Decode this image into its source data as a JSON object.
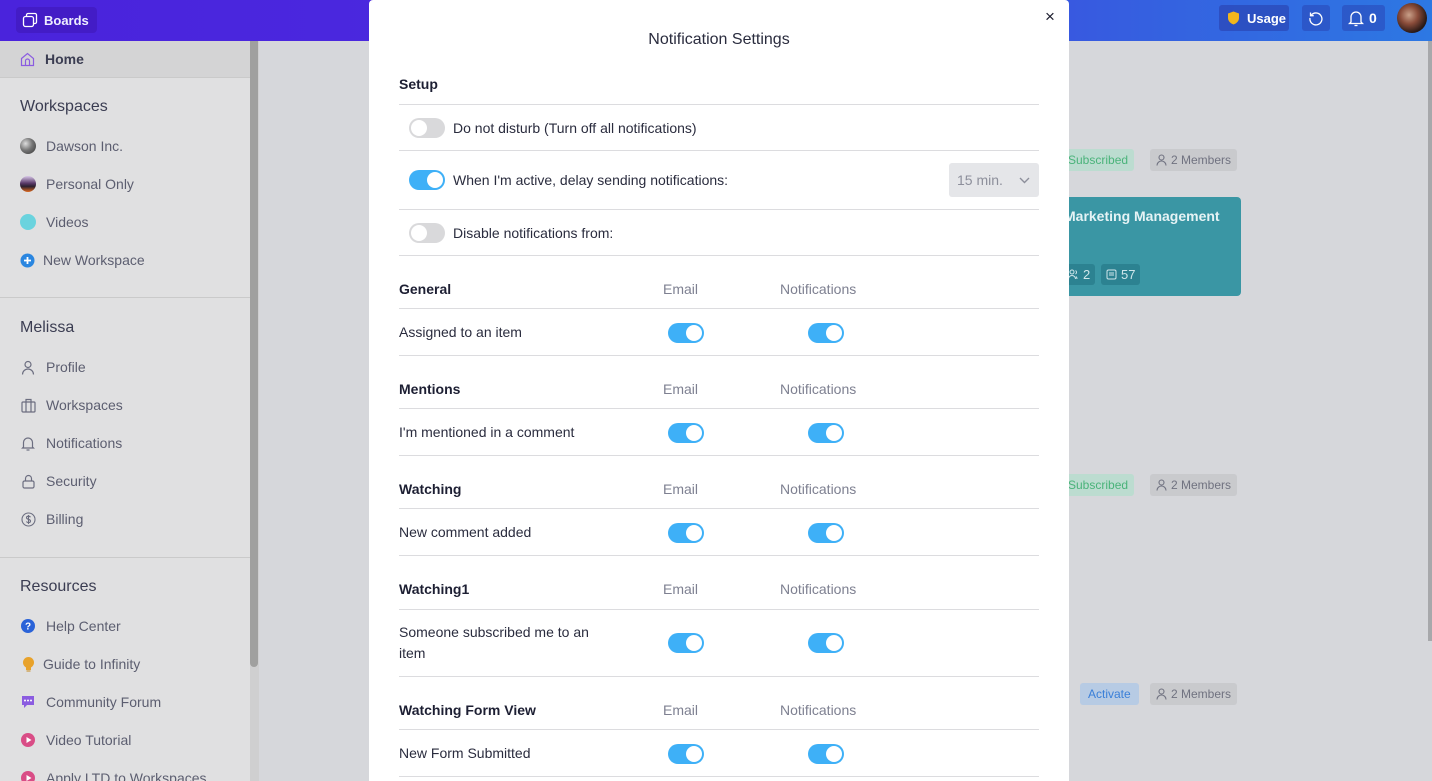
{
  "topbar": {
    "app_label": "Boards",
    "usage_label": "Usage",
    "notification_count": "0",
    "colors": {
      "usage_shield": "#f2b61d"
    }
  },
  "sidebar": {
    "home_label": "Home",
    "workspaces_heading": "Workspaces",
    "workspaces": [
      {
        "label": "Dawson Inc.",
        "color": "#6b6b6b"
      },
      {
        "label": "Personal Only",
        "color": "#5a4a6a"
      },
      {
        "label": "Videos",
        "color": "#6ad3de"
      }
    ],
    "new_workspace_label": "New Workspace",
    "user_heading": "Melissa",
    "user_items": [
      {
        "label": "Profile",
        "icon": "user-icon"
      },
      {
        "label": "Workspaces",
        "icon": "briefcase-icon"
      },
      {
        "label": "Notifications",
        "icon": "bell-icon"
      },
      {
        "label": "Security",
        "icon": "lock-icon"
      },
      {
        "label": "Billing",
        "icon": "dollar-icon"
      }
    ],
    "resources_heading": "Resources",
    "resources": [
      {
        "label": "Help Center",
        "icon": "help-icon",
        "color": "#2a63d8"
      },
      {
        "label": "Guide to Infinity",
        "icon": "lightbulb-icon",
        "color": "#e8a22a"
      },
      {
        "label": "Community Forum",
        "icon": "chat-icon",
        "color": "#8b5ce0"
      },
      {
        "label": "Video Tutorial",
        "icon": "play-icon",
        "color": "#d94d86"
      },
      {
        "label": "Apply LTD to Workspaces",
        "icon": "play-icon",
        "color": "#d94d86"
      }
    ]
  },
  "background": {
    "workspace_rows": [
      {
        "status": "Subscribed",
        "members": "2 Members"
      },
      {
        "status": "Subscribed",
        "members": "2 Members"
      },
      {
        "status": "Activate",
        "members": "2 Members"
      }
    ],
    "board_card": {
      "title": "Marketing Management",
      "members_count": "2",
      "items_count": "57",
      "color": "#3a96a4"
    }
  },
  "modal": {
    "title": "Notification Settings",
    "close_label": "×",
    "setup": {
      "heading": "Setup",
      "do_not_disturb": {
        "label": "Do not disturb (Turn off all notifications)",
        "on": false
      },
      "delay": {
        "label": "When I'm active, delay sending notifications:",
        "on": true,
        "value": "15 min."
      },
      "disable_from": {
        "label": "Disable notifications from:",
        "on": false
      }
    },
    "column_email": "Email",
    "column_notifications": "Notifications",
    "sections": [
      {
        "heading": "General",
        "rows": [
          {
            "label": "Assigned to an item",
            "email": true,
            "notifications": true
          }
        ]
      },
      {
        "heading": "Mentions",
        "rows": [
          {
            "label": "I'm mentioned in a comment",
            "email": true,
            "notifications": true
          }
        ]
      },
      {
        "heading": "Watching",
        "rows": [
          {
            "label": "New comment added",
            "email": true,
            "notifications": true
          }
        ]
      },
      {
        "heading": "Watching1",
        "rows": [
          {
            "label": "Someone subscribed me to an item",
            "email": true,
            "notifications": true
          }
        ]
      },
      {
        "heading": "Watching Form View",
        "rows": [
          {
            "label": "New Form Submitted",
            "email": true,
            "notifications": true
          }
        ]
      }
    ],
    "colors": {
      "toggle_on": "#3eb0f7",
      "toggle_off": "#d9d9db"
    }
  }
}
